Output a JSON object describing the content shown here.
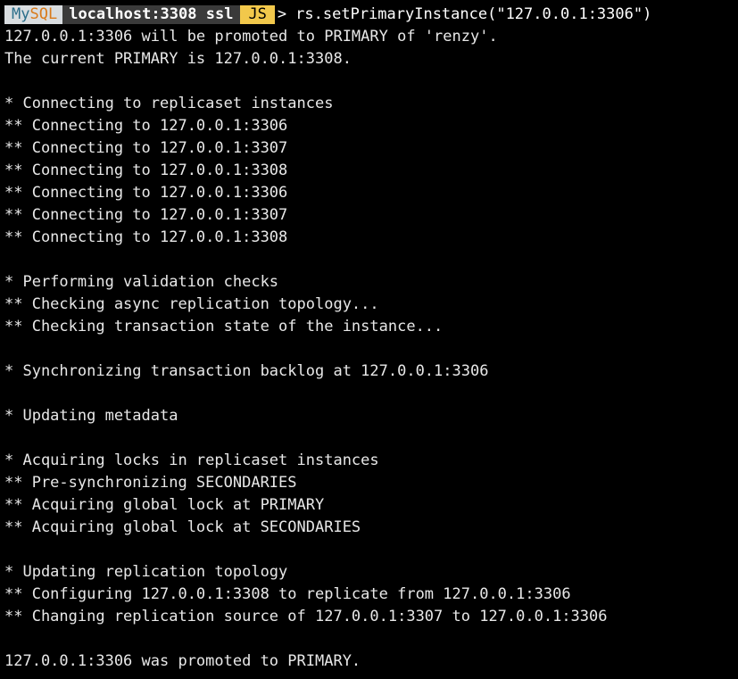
{
  "prompt": {
    "mode_prefix": "My",
    "mode_suffix": "SQL",
    "connection": "localhost:3308 ssl",
    "language": "JS",
    "arrow": ">",
    "command": "rs.setPrimaryInstance(\"127.0.0.1:3306\")"
  },
  "output": [
    "127.0.0.1:3306 will be promoted to PRIMARY of 'renzy'.",
    "The current PRIMARY is 127.0.0.1:3308.",
    "",
    "* Connecting to replicaset instances",
    "** Connecting to 127.0.0.1:3306",
    "** Connecting to 127.0.0.1:3307",
    "** Connecting to 127.0.0.1:3308",
    "** Connecting to 127.0.0.1:3306",
    "** Connecting to 127.0.0.1:3307",
    "** Connecting to 127.0.0.1:3308",
    "",
    "* Performing validation checks",
    "** Checking async replication topology...",
    "** Checking transaction state of the instance...",
    "",
    "* Synchronizing transaction backlog at 127.0.0.1:3306",
    "",
    "* Updating metadata",
    "",
    "* Acquiring locks in replicaset instances",
    "** Pre-synchronizing SECONDARIES",
    "** Acquiring global lock at PRIMARY",
    "** Acquiring global lock at SECONDARIES",
    "",
    "* Updating replication topology",
    "** Configuring 127.0.0.1:3308 to replicate from 127.0.0.1:3306",
    "** Changing replication source of 127.0.0.1:3307 to 127.0.0.1:3306",
    "",
    "127.0.0.1:3306 was promoted to PRIMARY."
  ],
  "colors": {
    "background": "#000000",
    "text": "#e8e8e8",
    "mysql_segment_bg": "#d9dde0",
    "mysql_my": "#2b6e8a",
    "mysql_sql": "#d97a1a",
    "host_segment_bg": "#3a3a3a",
    "js_segment_bg": "#f2c84b"
  }
}
